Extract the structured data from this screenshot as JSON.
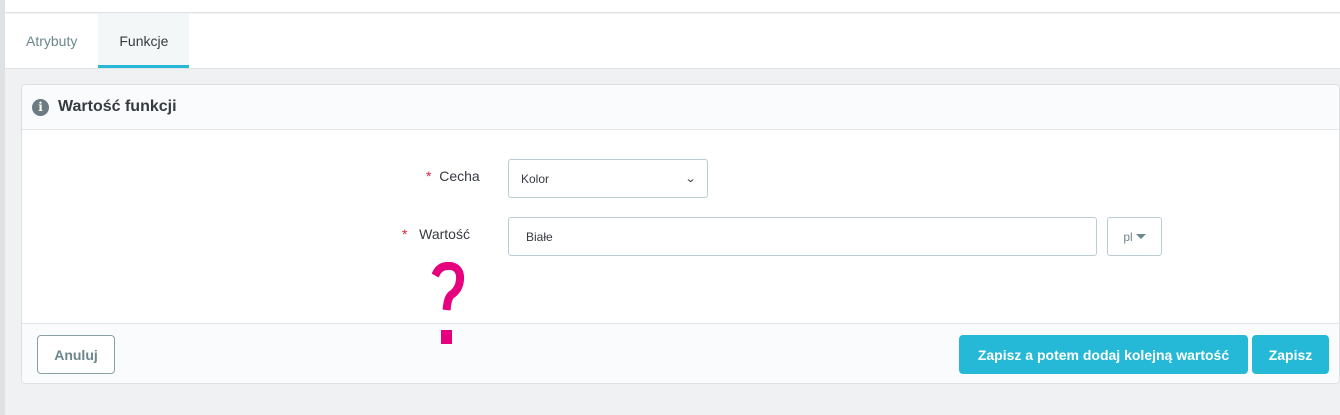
{
  "tabs": [
    {
      "label": "Atrybuty",
      "active": false
    },
    {
      "label": "Funkcje",
      "active": true
    }
  ],
  "panel": {
    "title": "Wartość funkcji",
    "icon": "info-icon"
  },
  "form": {
    "required_mark": "*",
    "feature": {
      "label": "Cecha",
      "value": "Kolor"
    },
    "value": {
      "label": "Wartość",
      "value": "Białe",
      "lang": "pl"
    }
  },
  "footer": {
    "cancel_label": "Anuluj",
    "save_add_label": "Zapisz a potem dodaj kolejną wartość",
    "save_label": "Zapisz"
  },
  "colors": {
    "accent": "#25b9d7",
    "required": "#e3203a",
    "annotation": "#e6007e"
  }
}
